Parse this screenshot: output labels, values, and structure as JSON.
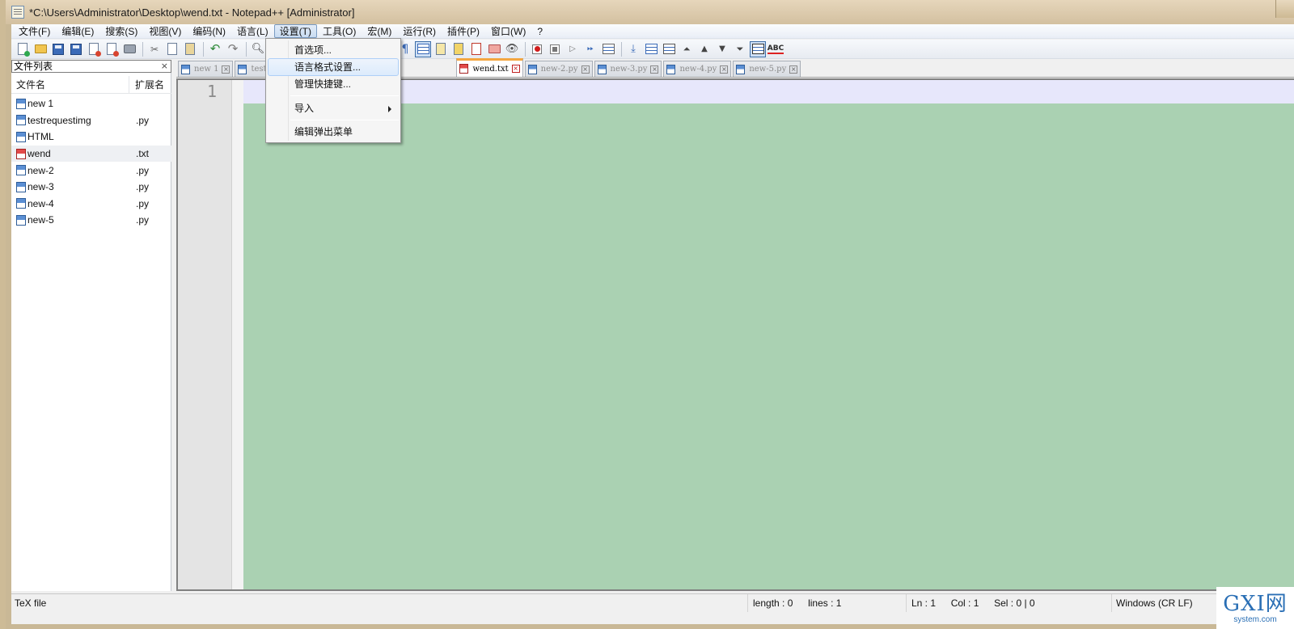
{
  "window": {
    "title": "*C:\\Users\\Administrator\\Desktop\\wend.txt - Notepad++ [Administrator]"
  },
  "menubar": {
    "items": [
      "文件(F)",
      "编辑(E)",
      "搜索(S)",
      "视图(V)",
      "编码(N)",
      "语言(L)",
      "设置(T)",
      "工具(O)",
      "宏(M)",
      "运行(R)",
      "插件(P)",
      "窗口(W)",
      "?"
    ],
    "active": "设置(T)"
  },
  "toolbar": {
    "icons": [
      "new-file-icon",
      "open-folder-icon",
      "save-icon",
      "save-all-icon",
      "close-icon",
      "close-all-icon",
      "print-icon",
      "cut-icon",
      "copy-icon",
      "paste-icon",
      "undo-icon",
      "redo-icon",
      "find-icon",
      "show-all-chars-icon",
      "indent-guide-icon",
      "word-wrap-icon",
      "doc-map-icon",
      "function-list-icon",
      "folder-workspace-icon",
      "monitor-icon",
      "macro-record-icon",
      "macro-stop-icon",
      "macro-play-icon",
      "macro-run-multiple-icon",
      "macro-save-icon",
      "sync-scroll-icon",
      "column-icon",
      "compare-icon",
      "fold-all-icon",
      "move-up-icon",
      "move-down-icon",
      "unfold-icon",
      "panel-icon",
      "spell-check-icon"
    ],
    "spell_label": "ABC",
    "pilcrow": "¶"
  },
  "panel": {
    "title": "文件列表",
    "close_glyph": "×",
    "col_name": "文件名",
    "col_ext": "扩展名",
    "files": [
      {
        "name": "new 1",
        "ext": "",
        "modified": false
      },
      {
        "name": "testrequestimg",
        "ext": ".py",
        "modified": false
      },
      {
        "name": "HTML",
        "ext": "",
        "modified": false
      },
      {
        "name": "wend",
        "ext": ".txt",
        "modified": true
      },
      {
        "name": "new-2",
        "ext": ".py",
        "modified": false
      },
      {
        "name": "new-3",
        "ext": ".py",
        "modified": false
      },
      {
        "name": "new-4",
        "ext": ".py",
        "modified": false
      },
      {
        "name": "new-5",
        "ext": ".py",
        "modified": false
      }
    ]
  },
  "tabs": [
    {
      "label": "new 1",
      "active": false,
      "modified": false
    },
    {
      "label": "test",
      "active": false,
      "modified": false
    },
    {
      "label": "wend.txt",
      "active": true,
      "modified": true
    },
    {
      "label": "new-2.py",
      "active": false,
      "modified": false
    },
    {
      "label": "new-3.py",
      "active": false,
      "modified": false
    },
    {
      "label": "new-4.py",
      "active": false,
      "modified": false
    },
    {
      "label": "new-5.py",
      "active": false,
      "modified": false
    }
  ],
  "tab_close_glyph": "×",
  "editor": {
    "line_number": "1",
    "background": "#aad1b2",
    "current_line_color": "#e7e7fb"
  },
  "dropdown": {
    "items": [
      {
        "label": "首选项...",
        "highlighted": false,
        "submenu": false
      },
      {
        "label": "语言格式设置...",
        "highlighted": true,
        "submenu": false
      },
      {
        "label": "管理快捷键...",
        "highlighted": false,
        "submenu": false
      },
      {
        "label": "导入",
        "highlighted": false,
        "submenu": true
      },
      {
        "label": "编辑弹出菜单",
        "highlighted": false,
        "submenu": false
      }
    ]
  },
  "statusbar": {
    "file_type": "TeX file",
    "length": "length : 0",
    "lines": "lines : 1",
    "ln": "Ln : 1",
    "col": "Col : 1",
    "sel": "Sel : 0 | 0",
    "eol": "Windows (CR LF)"
  },
  "watermark": {
    "logo": "GXI网",
    "url": "system.com"
  }
}
